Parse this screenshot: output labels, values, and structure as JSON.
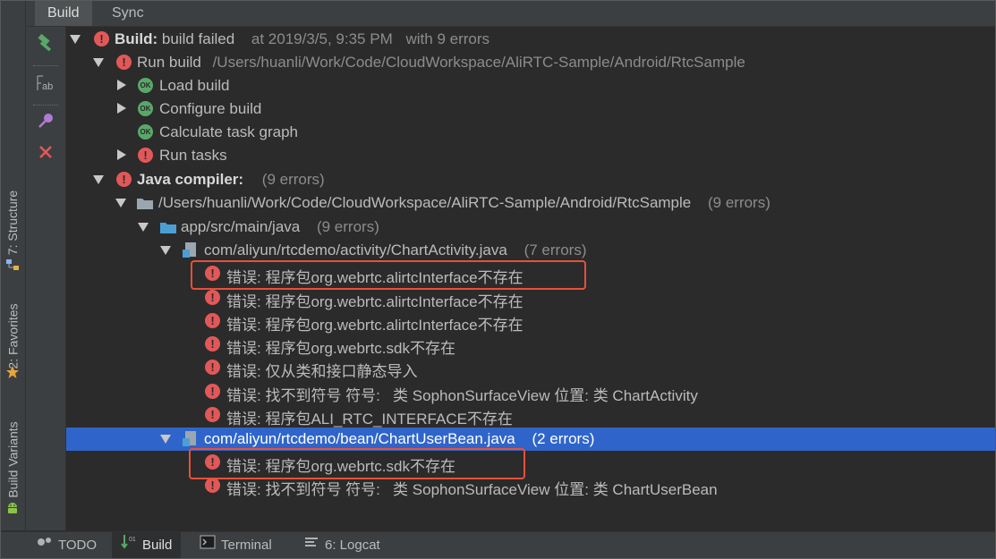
{
  "tabs": [
    "Build",
    "Sync"
  ],
  "side_tabs": {
    "structure": "7: Structure",
    "favorites": "2: Favorites",
    "variants": "Build Variants"
  },
  "bottom": {
    "todo": "TODO",
    "build": "Build",
    "terminal": "Terminal",
    "logcat": "6: Logcat"
  },
  "tree": {
    "root": {
      "label": "Build:",
      "status": "build failed",
      "time": "at 2019/3/5, 9:35 PM",
      "errors": "with 9 errors"
    },
    "run_build": {
      "label": "Run build",
      "path": "/Users/huanli/Work/Code/CloudWorkspace/AliRTC-Sample/Android/RtcSample"
    },
    "load_build": "Load build",
    "configure_build": "Configure build",
    "calc_graph": "Calculate task graph",
    "run_tasks": "Run tasks",
    "java_compiler": {
      "label": "Java compiler:",
      "count": "(9 errors)"
    },
    "project": {
      "path": "/Users/huanli/Work/Code/CloudWorkspace/AliRTC-Sample/Android/RtcSample",
      "count": "(9 errors)"
    },
    "src": {
      "path": "app/src/main/java",
      "count": "(9 errors)"
    },
    "chart_activity": {
      "file": "com/aliyun/rtcdemo/activity/ChartActivity.java",
      "count": "(7 errors)"
    },
    "chart_activity_errors": [
      "错误: 程序包org.webrtc.alirtcInterface不存在",
      "错误: 程序包org.webrtc.alirtcInterface不存在",
      "错误: 程序包org.webrtc.alirtcInterface不存在",
      "错误: 程序包org.webrtc.sdk不存在",
      "错误: 仅从类和接口静态导入",
      "错误: 找不到符号 符号:   类 SophonSurfaceView 位置: 类 ChartActivity",
      "错误: 程序包ALI_RTC_INTERFACE不存在"
    ],
    "chart_user_bean": {
      "file": "com/aliyun/rtcdemo/bean/ChartUserBean.java",
      "count": "(2 errors)"
    },
    "chart_user_bean_errors": [
      "错误: 程序包org.webrtc.sdk不存在",
      "错误: 找不到符号 符号:   类 SophonSurfaceView 位置: 类 ChartUserBean"
    ]
  },
  "colors": {
    "error": "#e25858",
    "ok": "#59a869",
    "selection": "#2f65ca",
    "highlight": "#e8503a"
  }
}
